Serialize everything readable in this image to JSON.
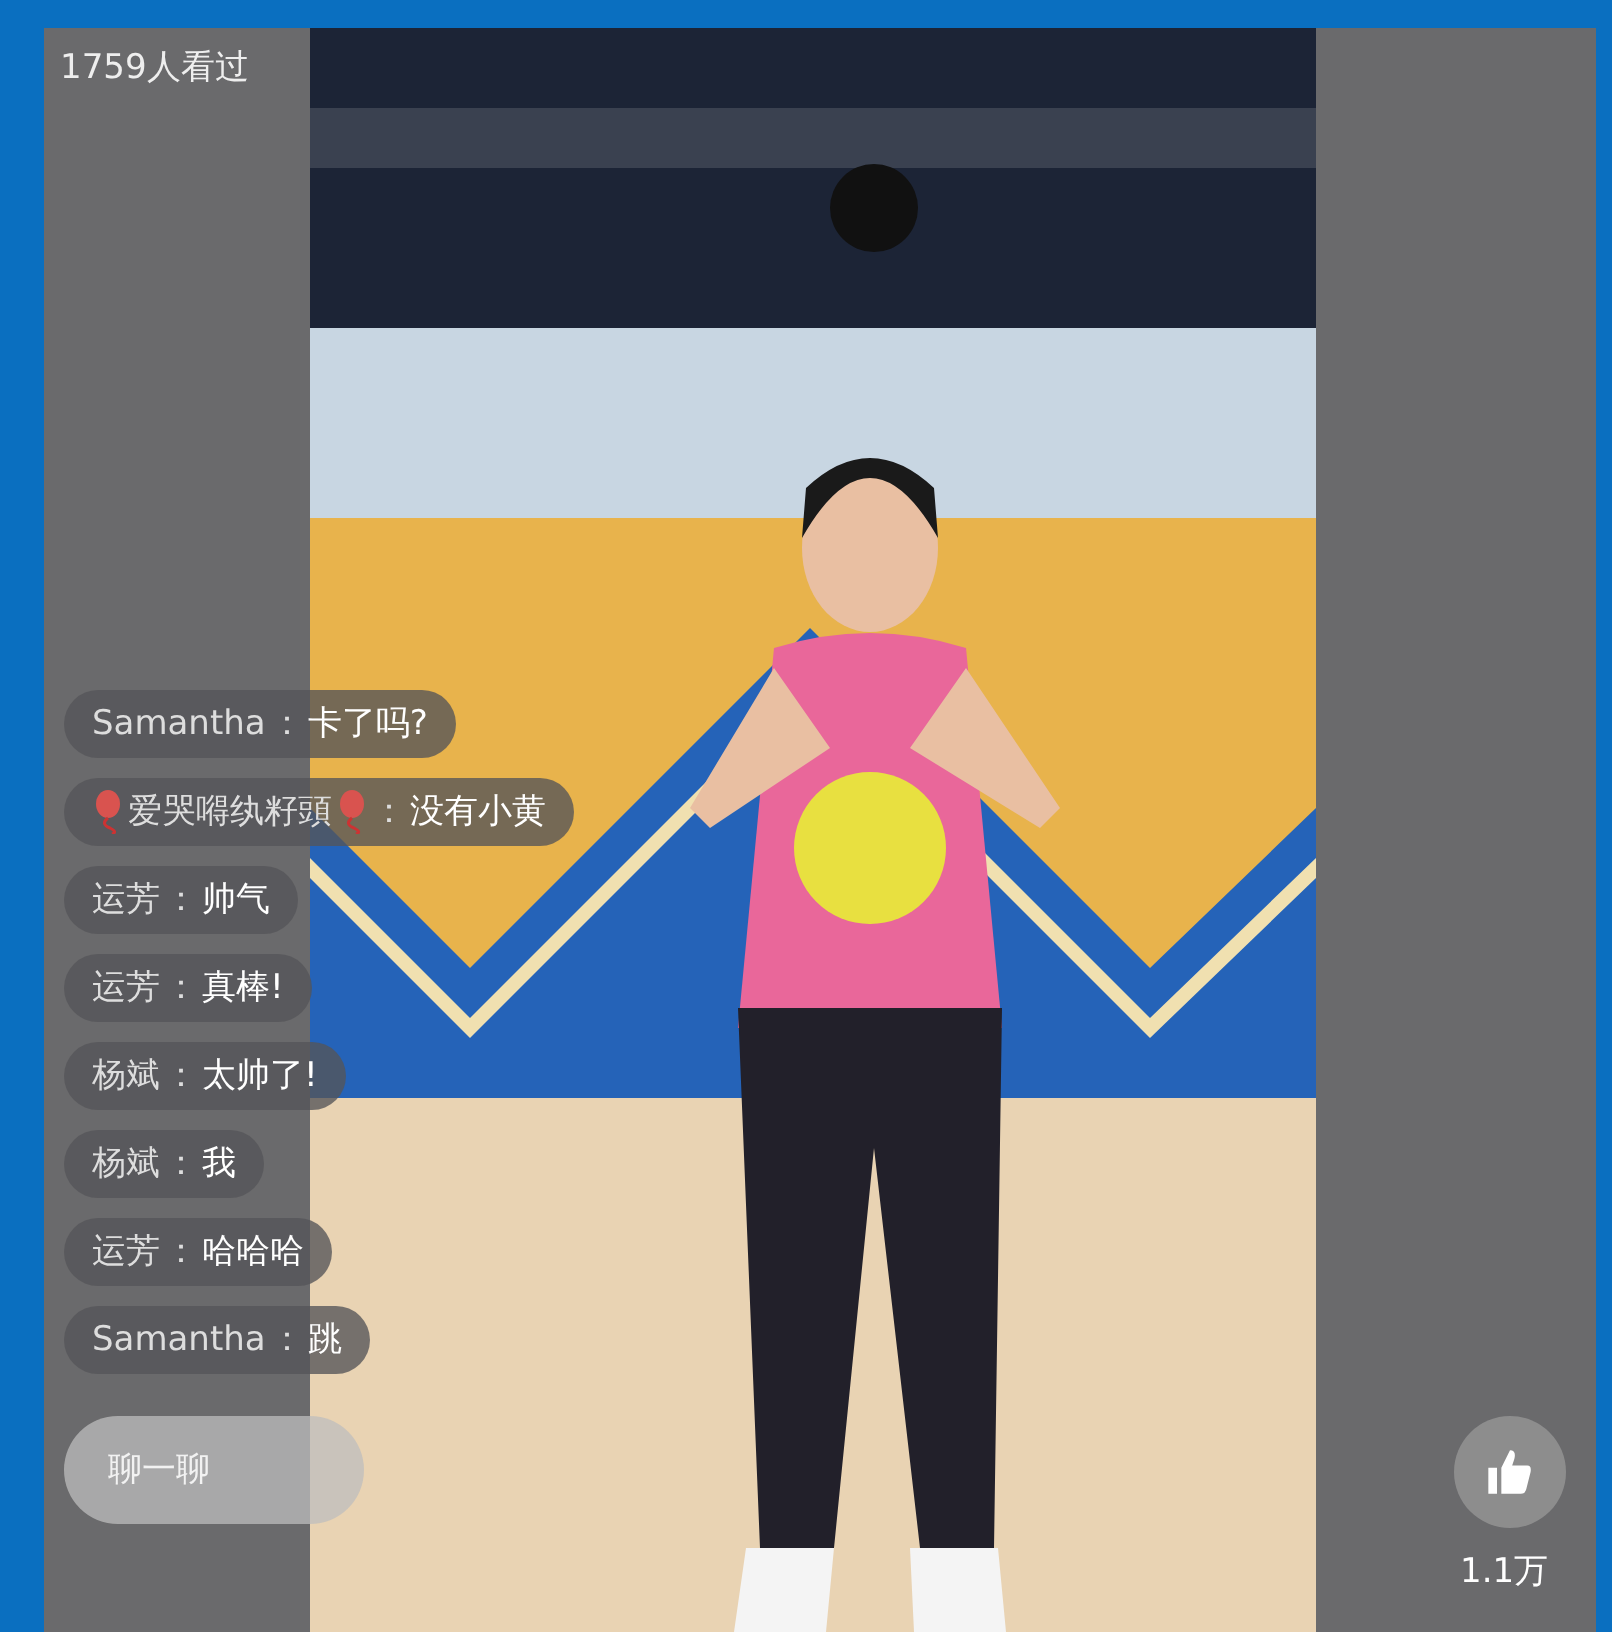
{
  "viewers": "1759人看过",
  "comments": [
    {
      "user": "Samantha",
      "separator": "：",
      "text": "卡了吗?",
      "balloon_badges": false
    },
    {
      "user": "爱哭嘚纨籽頭",
      "separator": "：",
      "text": "没有小黄",
      "balloon_badges": true
    },
    {
      "user": "运芳",
      "separator": "：",
      "text": "帅气",
      "balloon_badges": false
    },
    {
      "user": "运芳",
      "separator": "：",
      "text": "真棒!",
      "balloon_badges": false
    },
    {
      "user": "杨斌",
      "separator": "：",
      "text": "太帅了!",
      "balloon_badges": false
    },
    {
      "user": "杨斌",
      "separator": "：",
      "text": "我",
      "balloon_badges": false
    },
    {
      "user": "运芳",
      "separator": "：",
      "text": "哈哈哈",
      "balloon_badges": false
    },
    {
      "user": "Samantha",
      "separator": "：",
      "text": "跳",
      "balloon_badges": false
    }
  ],
  "chat": {
    "placeholder": "聊一聊"
  },
  "likes": "1.1万"
}
